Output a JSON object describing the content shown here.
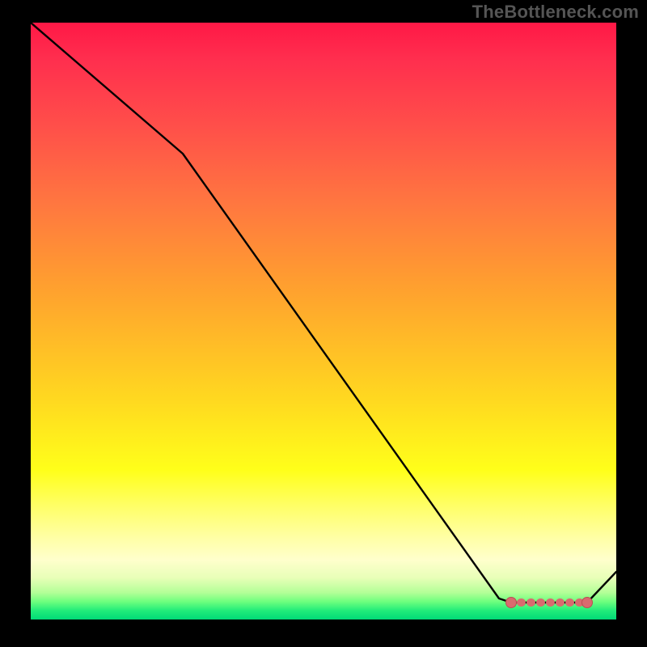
{
  "watermark": "TheBottleneck.com",
  "chart_data": {
    "type": "line",
    "title": "",
    "xlabel": "",
    "ylabel": "",
    "xlim": [
      0,
      100
    ],
    "ylim": [
      0,
      100
    ],
    "series": [
      {
        "name": "curve",
        "x": [
          0,
          26,
          80,
          82,
          95,
          100
        ],
        "y": [
          100,
          78,
          3.5,
          2.8,
          2.8,
          8
        ]
      }
    ],
    "markers": [
      {
        "name": "segment-start",
        "x": 82,
        "y": 2.8
      },
      {
        "name": "segment-end",
        "x": 95,
        "y": 2.8
      }
    ],
    "highlight_segment": {
      "x_start": 82,
      "x_end": 95,
      "y": 2.8
    },
    "colors": {
      "line": "#000000",
      "marker_fill": "#d96a6f",
      "marker_stroke": "#b94e52"
    }
  }
}
